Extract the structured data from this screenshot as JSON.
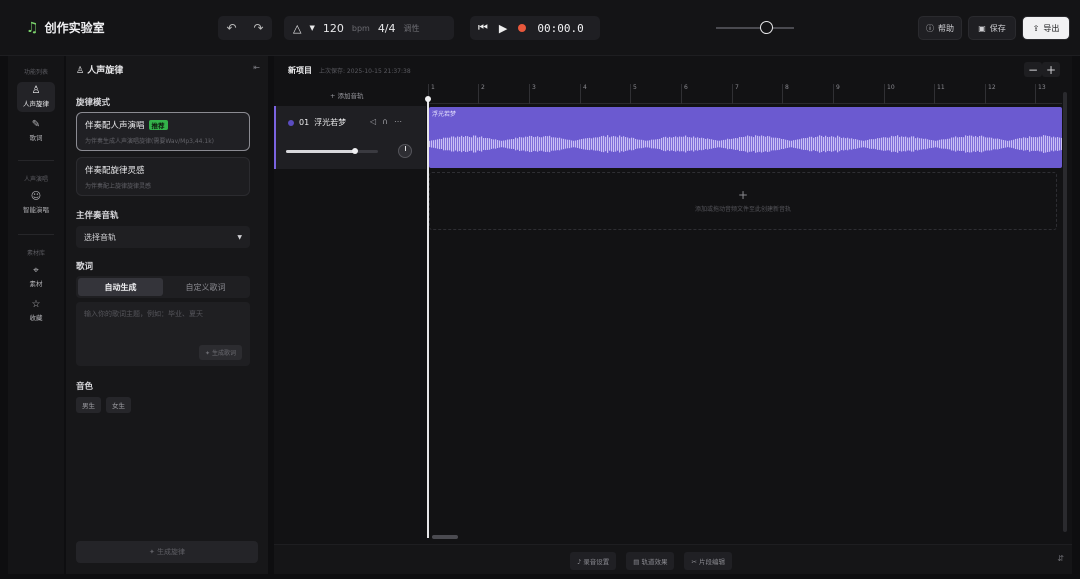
{
  "app": {
    "title": "创作实验室"
  },
  "toolbar": {
    "undo_icon": "undo-icon",
    "redo_icon": "redo-icon",
    "tempo_value": "120",
    "tempo_unit": "bpm",
    "time_signature": "4/4",
    "key_label": "调性",
    "time": "00:00.0",
    "help_label": "帮助",
    "save_label": "保存",
    "export_label": "导出"
  },
  "leftnav": {
    "groups": [
      {
        "label": "功能列表",
        "items": [
          {
            "label": "人声旋律",
            "icon": "person-icon",
            "active": true
          },
          {
            "label": "歌词",
            "icon": "pen-icon",
            "active": false
          }
        ]
      },
      {
        "label": "人声演唱",
        "items": [
          {
            "label": "智能演唱",
            "icon": "robot-icon",
            "active": false
          }
        ]
      },
      {
        "label": "素材库",
        "items": [
          {
            "label": "素材",
            "icon": "pin-icon",
            "active": false
          },
          {
            "label": "收藏",
            "icon": "star-icon",
            "active": false
          }
        ]
      }
    ]
  },
  "panel": {
    "title": "人声旋律",
    "melody_mode_label": "旋律模式",
    "modes": [
      {
        "title": "伴奏配人声演唱",
        "badge": "推荐",
        "desc": "为伴奏生成人声演唱旋律(需要Wav/Mp3,44.1k)",
        "selected": true
      },
      {
        "title": "伴奏配旋律灵感",
        "badge": "",
        "desc": "为伴奏配上旋律旋律灵感",
        "selected": false
      }
    ],
    "accompaniment_label": "主伴奏音轨",
    "accompaniment_placeholder": "选择音轨",
    "lyrics_label": "歌词",
    "lyrics_tabs": [
      "自动生成",
      "自定义歌词"
    ],
    "lyrics_placeholder": "输入你的歌词主题，例如：毕业、夏天",
    "gen_lyrics_label": "生成歌词",
    "voice_label": "音色",
    "voices": [
      "男生",
      "女生"
    ],
    "generate_label": "生成旋律"
  },
  "main": {
    "project_name": "新项目",
    "saved_text": "上次保存: 2025-10-15 21:37:38",
    "add_track_label": "+ 添加音轨",
    "ruler_ticks": [
      "1",
      "2",
      "3",
      "4",
      "5",
      "6",
      "7",
      "8",
      "9",
      "10",
      "11",
      "12",
      "13"
    ],
    "track": {
      "number": "01",
      "name": "浮光若梦",
      "clip_label": "浮光若梦",
      "volume": 0.75
    },
    "drop_hint": "添加或拖动音频文件至此创建新音轨",
    "bottom_buttons": [
      "录音设置",
      "轨道效果",
      "片段编辑"
    ]
  },
  "colors": {
    "accent": "#7a63e0",
    "clip": "#6b5ad0",
    "badge": "#33b24a",
    "record": "#e8583c"
  }
}
